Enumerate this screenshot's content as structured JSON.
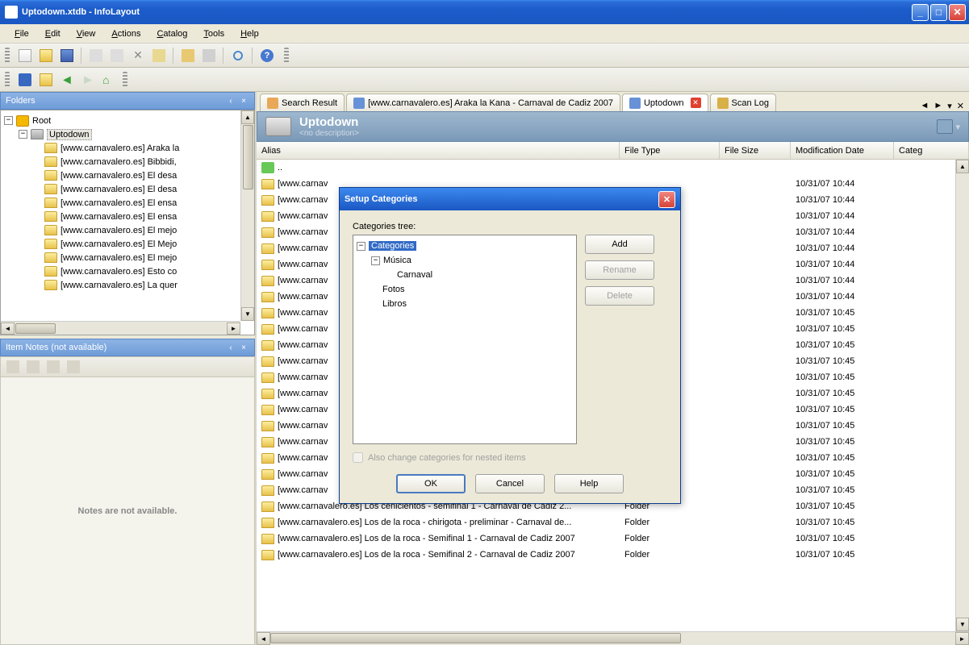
{
  "window": {
    "title": "Uptodown.xtdb - InfoLayout"
  },
  "menu": {
    "file": "File",
    "edit": "Edit",
    "view": "View",
    "actions": "Actions",
    "catalog": "Catalog",
    "tools": "Tools",
    "help": "Help"
  },
  "panels": {
    "folders": "Folders",
    "notes_header": "Item Notes (not available)",
    "notes_body": "Notes are not available."
  },
  "tree": {
    "root": "Root",
    "selected": "Uptodown",
    "children": [
      "[www.carnavalero.es] Araka la",
      "[www.carnavalero.es] Bibbidi,",
      "[www.carnavalero.es] El desa",
      "[www.carnavalero.es] El desa",
      "[www.carnavalero.es] El ensa",
      "[www.carnavalero.es] El ensa",
      "[www.carnavalero.es] El mejo",
      "[www.carnavalero.es] El Mejo",
      "[www.carnavalero.es] El mejo",
      "[www.carnavalero.es] Esto co",
      "[www.carnavalero.es] La quer"
    ]
  },
  "tabs": {
    "t1": "Search Result",
    "t2": "[www.carnavalero.es] Araka la Kana - Carnaval de Cadiz 2007",
    "t3": "Uptodown",
    "t4": "Scan Log"
  },
  "content": {
    "title": "Uptodown",
    "subtitle": "<no description>"
  },
  "columns": {
    "alias": "Alias",
    "ftype": "File Type",
    "fsize": "File Size",
    "mdate": "Modification Date",
    "categ": "Categ"
  },
  "up_row": "..",
  "rows": [
    {
      "alias": "[www.carnav",
      "ftype": "",
      "mdate": "10/31/07 10:44"
    },
    {
      "alias": "[www.carnav",
      "ftype": "",
      "mdate": "10/31/07 10:44"
    },
    {
      "alias": "[www.carnav",
      "ftype": "",
      "mdate": "10/31/07 10:44"
    },
    {
      "alias": "[www.carnav",
      "ftype": "",
      "mdate": "10/31/07 10:44"
    },
    {
      "alias": "[www.carnav",
      "ftype": "",
      "mdate": "10/31/07 10:44"
    },
    {
      "alias": "[www.carnav",
      "ftype": "",
      "mdate": "10/31/07 10:44"
    },
    {
      "alias": "[www.carnav",
      "ftype": "",
      "mdate": "10/31/07 10:44"
    },
    {
      "alias": "[www.carnav",
      "ftype": "",
      "mdate": "10/31/07 10:44"
    },
    {
      "alias": "[www.carnav",
      "ftype": "",
      "mdate": "10/31/07 10:45"
    },
    {
      "alias": "[www.carnav",
      "ftype": "",
      "mdate": "10/31/07 10:45"
    },
    {
      "alias": "[www.carnav",
      "ftype": "",
      "mdate": "10/31/07 10:45"
    },
    {
      "alias": "[www.carnav",
      "ftype": "",
      "mdate": "10/31/07 10:45"
    },
    {
      "alias": "[www.carnav",
      "ftype": "",
      "mdate": "10/31/07 10:45"
    },
    {
      "alias": "[www.carnav",
      "ftype": "",
      "mdate": "10/31/07 10:45"
    },
    {
      "alias": "[www.carnav",
      "ftype": "",
      "mdate": "10/31/07 10:45"
    },
    {
      "alias": "[www.carnav",
      "ftype": "",
      "mdate": "10/31/07 10:45"
    },
    {
      "alias": "[www.carnav",
      "ftype": "",
      "mdate": "10/31/07 10:45"
    },
    {
      "alias": "[www.carnav",
      "ftype": "",
      "mdate": "10/31/07 10:45"
    },
    {
      "alias": "[www.carnav",
      "ftype": "",
      "mdate": "10/31/07 10:45"
    },
    {
      "alias": "[www.carnav",
      "ftype": "",
      "mdate": "10/31/07 10:45"
    },
    {
      "alias": "[www.carnavalero.es] Los cenicientos - semifinal 1 - Carnaval de Cadiz 2...",
      "ftype": "Folder",
      "mdate": "10/31/07 10:45"
    },
    {
      "alias": "[www.carnavalero.es] Los de la roca - chirigota - preliminar - Carnaval de...",
      "ftype": "Folder",
      "mdate": "10/31/07 10:45"
    },
    {
      "alias": "[www.carnavalero.es] Los de la roca - Semifinal 1 - Carnaval de Cadiz 2007",
      "ftype": "Folder",
      "mdate": "10/31/07 10:45"
    },
    {
      "alias": "[www.carnavalero.es] Los de la roca - Semifinal 2 - Carnaval de Cadiz 2007",
      "ftype": "Folder",
      "mdate": "10/31/07 10:45"
    }
  ],
  "dialog": {
    "title": "Setup Categories",
    "tree_label": "Categories tree:",
    "root": "Categories",
    "nodes": {
      "musica": "Música",
      "carnaval": "Carnaval",
      "fotos": "Fotos",
      "libros": "Libros"
    },
    "btn_add": "Add",
    "btn_rename": "Rename",
    "btn_delete": "Delete",
    "check": "Also change categories for nested items",
    "ok": "OK",
    "cancel": "Cancel",
    "help": "Help"
  }
}
